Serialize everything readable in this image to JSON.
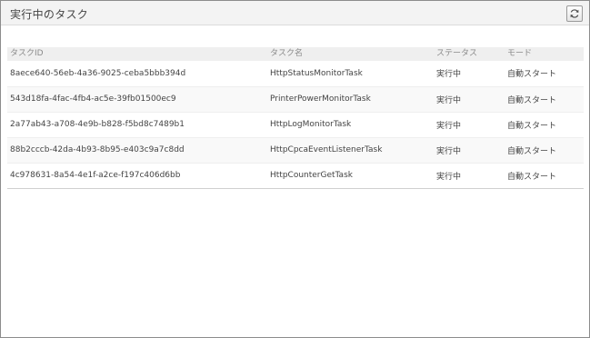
{
  "panel": {
    "title": "実行中のタスク",
    "refresh_icon": "refresh-icon"
  },
  "table": {
    "columns": [
      "タスクID",
      "タスク名",
      "ステータス",
      "モード"
    ],
    "rows": [
      {
        "id": "8aece640-56eb-4a36-9025-ceba5bbb394d",
        "name": "HttpStatusMonitorTask",
        "status": "実行中",
        "mode": "自動スタート"
      },
      {
        "id": "543d18fa-4fac-4fb4-ac5e-39fb01500ec9",
        "name": "PrinterPowerMonitorTask",
        "status": "実行中",
        "mode": "自動スタート"
      },
      {
        "id": "2a77ab43-a708-4e9b-b828-f5bd8c7489b1",
        "name": "HttpLogMonitorTask",
        "status": "実行中",
        "mode": "自動スタート"
      },
      {
        "id": "88b2cccb-42da-4b93-8b95-e403c9a7c8dd",
        "name": "HttpCpcaEventListenerTask",
        "status": "実行中",
        "mode": "自動スタート"
      },
      {
        "id": "4c978631-8a54-4e1f-a2ce-f197c406d6bb",
        "name": "HttpCounterGetTask",
        "status": "実行中",
        "mode": "自動スタート"
      }
    ]
  }
}
